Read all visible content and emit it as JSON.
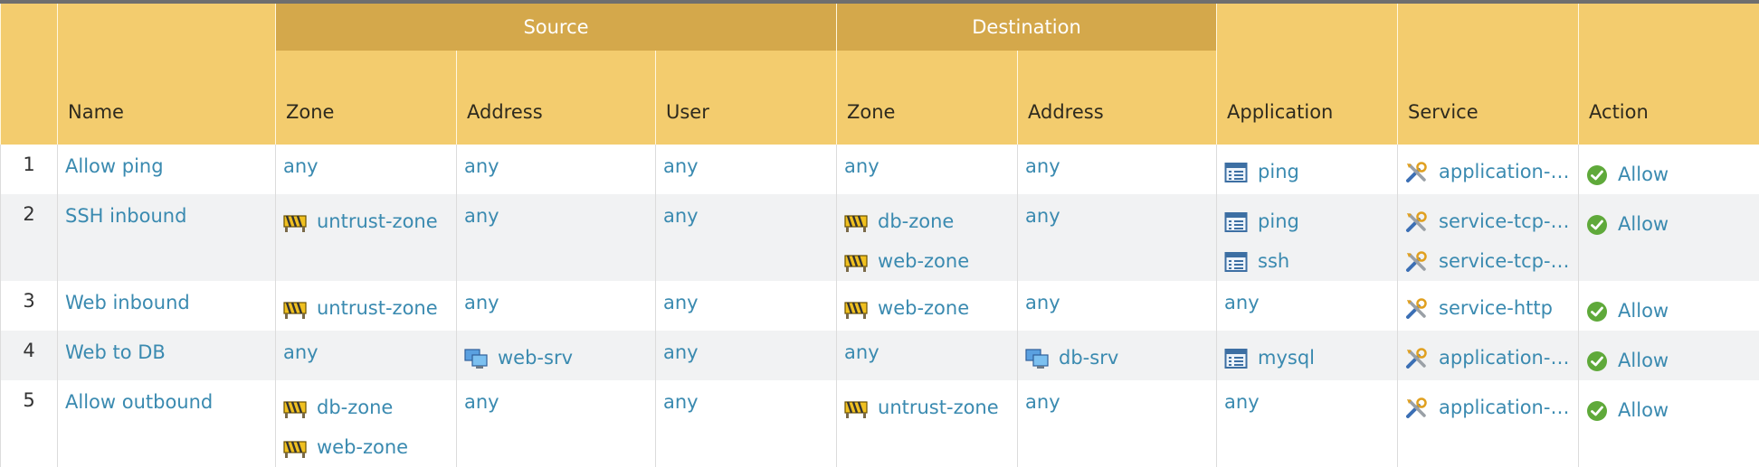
{
  "columns": {
    "name": "Name",
    "group_source": "Source",
    "group_destination": "Destination",
    "src_zone": "Zone",
    "src_address": "Address",
    "src_user": "User",
    "dst_zone": "Zone",
    "dst_address": "Address",
    "application": "Application",
    "service": "Service",
    "action": "Action"
  },
  "colors": {
    "header": "#f3cc6e",
    "group_header": "#d4a84b",
    "link": "#3a8ab0"
  },
  "rows": [
    {
      "num": "1",
      "name": "Allow ping",
      "src_zone": [
        {
          "text": "any",
          "icon": null
        }
      ],
      "src_address": [
        {
          "text": "any",
          "icon": null
        }
      ],
      "src_user": "any",
      "dst_zone": [
        {
          "text": "any",
          "icon": null
        }
      ],
      "dst_address": [
        {
          "text": "any",
          "icon": null
        }
      ],
      "application": [
        {
          "text": "ping",
          "icon": "application-icon"
        }
      ],
      "service": [
        {
          "text": "application-d...",
          "icon": "service-icon"
        }
      ],
      "action": "Allow"
    },
    {
      "num": "2",
      "name": "SSH inbound",
      "src_zone": [
        {
          "text": "untrust-zone",
          "icon": "zone-icon"
        }
      ],
      "src_address": [
        {
          "text": "any",
          "icon": null
        }
      ],
      "src_user": "any",
      "dst_zone": [
        {
          "text": "db-zone",
          "icon": "zone-icon"
        },
        {
          "text": "web-zone",
          "icon": "zone-icon"
        }
      ],
      "dst_address": [
        {
          "text": "any",
          "icon": null
        }
      ],
      "application": [
        {
          "text": "ping",
          "icon": "application-icon"
        },
        {
          "text": "ssh",
          "icon": "application-icon"
        }
      ],
      "service": [
        {
          "text": "service-tcp-2...",
          "icon": "service-icon"
        },
        {
          "text": "service-tcp-2...",
          "icon": "service-icon"
        }
      ],
      "action": "Allow"
    },
    {
      "num": "3",
      "name": "Web inbound",
      "src_zone": [
        {
          "text": "untrust-zone",
          "icon": "zone-icon"
        }
      ],
      "src_address": [
        {
          "text": "any",
          "icon": null
        }
      ],
      "src_user": "any",
      "dst_zone": [
        {
          "text": "web-zone",
          "icon": "zone-icon"
        }
      ],
      "dst_address": [
        {
          "text": "any",
          "icon": null
        }
      ],
      "application": [
        {
          "text": "any",
          "icon": null
        }
      ],
      "service": [
        {
          "text": "service-http",
          "icon": "service-icon"
        }
      ],
      "action": "Allow"
    },
    {
      "num": "4",
      "name": "Web to DB",
      "src_zone": [
        {
          "text": "any",
          "icon": null
        }
      ],
      "src_address": [
        {
          "text": "web-srv",
          "icon": "address-icon"
        }
      ],
      "src_user": "any",
      "dst_zone": [
        {
          "text": "any",
          "icon": null
        }
      ],
      "dst_address": [
        {
          "text": "db-srv",
          "icon": "address-icon"
        }
      ],
      "application": [
        {
          "text": "mysql",
          "icon": "application-icon"
        }
      ],
      "service": [
        {
          "text": "application-d...",
          "icon": "service-icon"
        }
      ],
      "action": "Allow"
    },
    {
      "num": "5",
      "name": "Allow outbound",
      "src_zone": [
        {
          "text": "db-zone",
          "icon": "zone-icon"
        },
        {
          "text": "web-zone",
          "icon": "zone-icon"
        }
      ],
      "src_address": [
        {
          "text": "any",
          "icon": null
        }
      ],
      "src_user": "any",
      "dst_zone": [
        {
          "text": "untrust-zone",
          "icon": "zone-icon"
        }
      ],
      "dst_address": [
        {
          "text": "any",
          "icon": null
        }
      ],
      "application": [
        {
          "text": "any",
          "icon": null
        }
      ],
      "service": [
        {
          "text": "application-d...",
          "icon": "service-icon"
        }
      ],
      "action": "Allow"
    }
  ]
}
